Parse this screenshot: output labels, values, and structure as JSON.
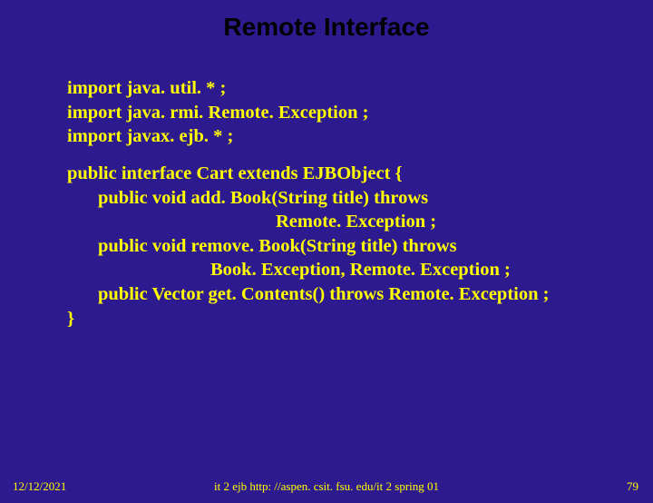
{
  "title": "Remote Interface",
  "code": {
    "import1": "import java. util. * ;",
    "import2": "import java. rmi. Remote. Exception ;",
    "import3": "import javax. ejb. * ;",
    "decl": "public interface Cart extends EJBObject {",
    "m1a": "public void add. Book(String title) throws",
    "m1b": "Remote. Exception ;",
    "m2a": "public void remove. Book(String title) throws",
    "m2b": "Book. Exception, Remote. Exception ;",
    "m3": "public Vector get. Contents() throws  Remote. Exception ;",
    "close": "}"
  },
  "footer": {
    "date": "12/12/2021",
    "center": "it 2 ejb  http: //aspen. csit. fsu. edu/it 2 spring 01",
    "page": "79"
  }
}
